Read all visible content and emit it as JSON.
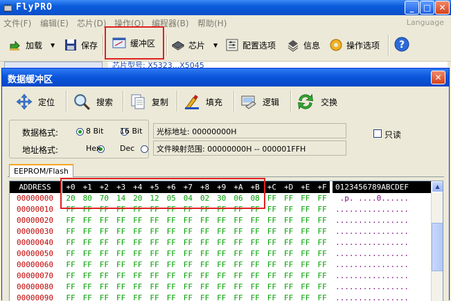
{
  "window": {
    "title": "FlyPRO",
    "language_label": "Language"
  },
  "menu": [
    "文件(F)",
    "编辑(E)",
    "芯片(D)",
    "操作(O)",
    "编程器(B)",
    "帮助(H)"
  ],
  "toolbar": {
    "load": "加载",
    "save": "保存",
    "buffer": "缓冲区",
    "chip": "芯片",
    "config": "配置选项",
    "info": "信息",
    "options": "操作选项"
  },
  "behind": {
    "text": "芯片型号: X5323...X5045"
  },
  "dialog": {
    "title": "数据缓冲区",
    "toolbar": {
      "locate": "定位",
      "search": "搜索",
      "copy": "复制",
      "fill": "填充",
      "logic": "逻辑",
      "swap": "交换"
    },
    "data_format_label": "数据格式:",
    "addr_format_label": "地址格式:",
    "data_format_options": [
      "8 Bit",
      "16 Bit"
    ],
    "data_format_selected": "8 Bit",
    "addr_format_options": [
      "Hex",
      "Dec"
    ],
    "addr_format_selected": "Hex",
    "cursor_address": "光标地址: 00000000H",
    "file_mapping": "文件映射范围: 00000000H -- 000001FFH",
    "readonly_label": "只读",
    "readonly": false,
    "tab": "EEPROM/Flash",
    "grid": {
      "address_header": "ADDRESS",
      "columns": [
        "+0",
        "+1",
        "+2",
        "+3",
        "+4",
        "+5",
        "+6",
        "+7",
        "+8",
        "+9",
        "+A",
        "+B",
        "+C",
        "+D",
        "+E",
        "+F"
      ],
      "ascii_header": "0123456789ABCDEF",
      "rows": [
        {
          "address": "00000000",
          "bytes": [
            "20",
            "80",
            "70",
            "14",
            "20",
            "12",
            "05",
            "04",
            "02",
            "30",
            "06",
            "08",
            "FF",
            "FF",
            "FF",
            "FF"
          ],
          "ascii": " .p. ....0......"
        },
        {
          "address": "00000010",
          "bytes": [
            "FF",
            "FF",
            "FF",
            "FF",
            "FF",
            "FF",
            "FF",
            "FF",
            "FF",
            "FF",
            "FF",
            "FF",
            "FF",
            "FF",
            "FF",
            "FF"
          ],
          "ascii": "................"
        },
        {
          "address": "00000020",
          "bytes": [
            "FF",
            "FF",
            "FF",
            "FF",
            "FF",
            "FF",
            "FF",
            "FF",
            "FF",
            "FF",
            "FF",
            "FF",
            "FF",
            "FF",
            "FF",
            "FF"
          ],
          "ascii": "................"
        },
        {
          "address": "00000030",
          "bytes": [
            "FF",
            "FF",
            "FF",
            "FF",
            "FF",
            "FF",
            "FF",
            "FF",
            "FF",
            "FF",
            "FF",
            "FF",
            "FF",
            "FF",
            "FF",
            "FF"
          ],
          "ascii": "................"
        },
        {
          "address": "00000040",
          "bytes": [
            "FF",
            "FF",
            "FF",
            "FF",
            "FF",
            "FF",
            "FF",
            "FF",
            "FF",
            "FF",
            "FF",
            "FF",
            "FF",
            "FF",
            "FF",
            "FF"
          ],
          "ascii": "................"
        },
        {
          "address": "00000050",
          "bytes": [
            "FF",
            "FF",
            "FF",
            "FF",
            "FF",
            "FF",
            "FF",
            "FF",
            "FF",
            "FF",
            "FF",
            "FF",
            "FF",
            "FF",
            "FF",
            "FF"
          ],
          "ascii": "................"
        },
        {
          "address": "00000060",
          "bytes": [
            "FF",
            "FF",
            "FF",
            "FF",
            "FF",
            "FF",
            "FF",
            "FF",
            "FF",
            "FF",
            "FF",
            "FF",
            "FF",
            "FF",
            "FF",
            "FF"
          ],
          "ascii": "................"
        },
        {
          "address": "00000070",
          "bytes": [
            "FF",
            "FF",
            "FF",
            "FF",
            "FF",
            "FF",
            "FF",
            "FF",
            "FF",
            "FF",
            "FF",
            "FF",
            "FF",
            "FF",
            "FF",
            "FF"
          ],
          "ascii": "................"
        },
        {
          "address": "00000080",
          "bytes": [
            "FF",
            "FF",
            "FF",
            "FF",
            "FF",
            "FF",
            "FF",
            "FF",
            "FF",
            "FF",
            "FF",
            "FF",
            "FF",
            "FF",
            "FF",
            "FF"
          ],
          "ascii": "................"
        },
        {
          "address": "00000090",
          "bytes": [
            "FF",
            "FF",
            "FF",
            "FF",
            "FF",
            "FF",
            "FF",
            "FF",
            "FF",
            "FF",
            "FF",
            "FF",
            "FF",
            "FF",
            "FF",
            "FF"
          ],
          "ascii": "................"
        }
      ]
    }
  },
  "colors": {
    "titlebar": "#0a5bdc",
    "highlight_box": "#e02020",
    "hex_text": "#00a000",
    "address_text": "#c00000",
    "ascii_text": "#7a007a"
  }
}
